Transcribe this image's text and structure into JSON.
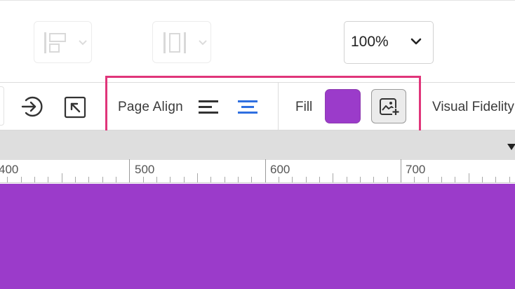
{
  "zoom": {
    "value": "100%"
  },
  "page_align": {
    "label": "Page Align"
  },
  "fill": {
    "label": "Fill",
    "color": "#9b3bca"
  },
  "visual_fidelity": {
    "label": "Visual Fidelity"
  },
  "ruler": {
    "labels": [
      "400",
      "500",
      "600",
      "700"
    ]
  },
  "canvas": {
    "color": "#9b3bca"
  },
  "highlight": {
    "color": "#e0357a"
  }
}
